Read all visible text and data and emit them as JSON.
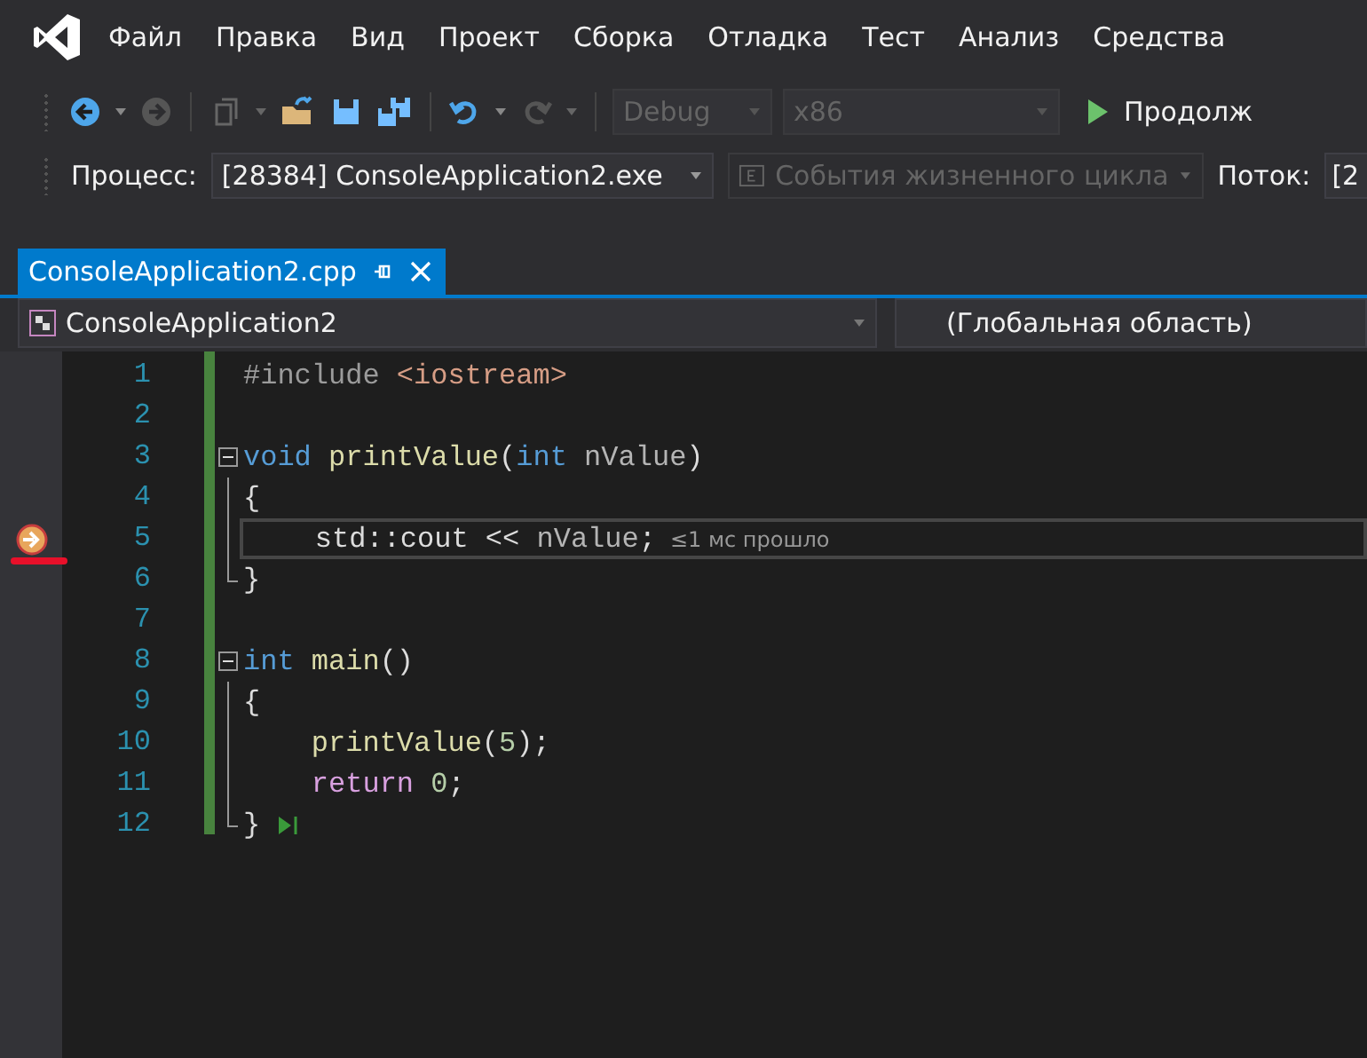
{
  "menu": [
    "Файл",
    "Правка",
    "Вид",
    "Проект",
    "Сборка",
    "Отладка",
    "Тест",
    "Анализ",
    "Средства"
  ],
  "toolbar": {
    "configuration": {
      "value": "Debug",
      "disabled": true
    },
    "platform": {
      "value": "x86",
      "disabled": true
    },
    "continue": "Продолж"
  },
  "debug_bar": {
    "process_label": "Процесс:",
    "process": "[28384] ConsoleApplication2.exe",
    "lifecycle": {
      "value": "События жизненного цикла",
      "disabled": true
    },
    "thread_label": "Поток:",
    "thread": "[2"
  },
  "tabs": [
    {
      "label": "ConsoleApplication2.cpp",
      "selected": true
    }
  ],
  "nav_bar": {
    "project": "ConsoleApplication2",
    "scope": "(Глобальная область)"
  },
  "lines": [
    {
      "number": "1",
      "kind": "plain",
      "current": false,
      "run_to_click": false,
      "tokens": [
        {
          "kind": "pre",
          "text": "#include"
        },
        {
          "kind": "string",
          "text": " <iostream>"
        }
      ]
    },
    {
      "number": "2",
      "kind": "plain",
      "current": false,
      "run_to_click": false
    },
    {
      "number": "3",
      "kind": "fold_start",
      "current": false,
      "run_to_click": false,
      "tokens": [
        {
          "kind": "keyword",
          "text": "void"
        },
        {
          "kind": "function",
          "text": " printValue"
        },
        {
          "kind": "plain",
          "text": "("
        },
        {
          "kind": "keyword",
          "text": "int"
        },
        {
          "kind": "param",
          "text": " nValue"
        },
        {
          "kind": "plain",
          "text": ")"
        }
      ]
    },
    {
      "number": "4",
      "kind": "block",
      "current": false,
      "run_to_click": false,
      "tokens": [
        {
          "kind": "plain",
          "text": "{"
        }
      ]
    },
    {
      "number": "5",
      "kind": "block",
      "current": true,
      "run_to_click": false,
      "hint": "≤1 мс прошло",
      "tokens": [
        {
          "kind": "plain",
          "text": "    std::cout << "
        },
        {
          "kind": "param",
          "text": "nValue"
        },
        {
          "kind": "plain",
          "text": ";"
        }
      ]
    },
    {
      "number": "6",
      "kind": "block_end",
      "current": false,
      "run_to_click": false,
      "tokens": [
        {
          "kind": "plain",
          "text": "}"
        }
      ]
    },
    {
      "number": "7",
      "kind": "plain",
      "current": false,
      "run_to_click": false
    },
    {
      "number": "8",
      "kind": "fold_start",
      "current": false,
      "run_to_click": false,
      "tokens": [
        {
          "kind": "keyword",
          "text": "int"
        },
        {
          "kind": "function",
          "text": " main"
        },
        {
          "kind": "plain",
          "text": "()"
        }
      ]
    },
    {
      "number": "9",
      "kind": "block",
      "current": false,
      "run_to_click": false,
      "tokens": [
        {
          "kind": "plain",
          "text": "{"
        }
      ]
    },
    {
      "number": "10",
      "kind": "block",
      "current": false,
      "run_to_click": false,
      "tokens": [
        {
          "kind": "function",
          "text": "    printValue"
        },
        {
          "kind": "plain",
          "text": "("
        },
        {
          "kind": "number",
          "text": "5"
        },
        {
          "kind": "plain",
          "text": ");"
        }
      ]
    },
    {
      "number": "11",
      "kind": "block",
      "current": false,
      "run_to_click": false,
      "tokens": [
        {
          "kind": "control",
          "text": "    return"
        },
        {
          "kind": "number",
          "text": " 0"
        },
        {
          "kind": "plain",
          "text": ";"
        }
      ]
    },
    {
      "number": "12",
      "kind": "block_end",
      "current": false,
      "run_to_click": true,
      "tokens": [
        {
          "kind": "plain",
          "text": "}"
        }
      ]
    }
  ]
}
